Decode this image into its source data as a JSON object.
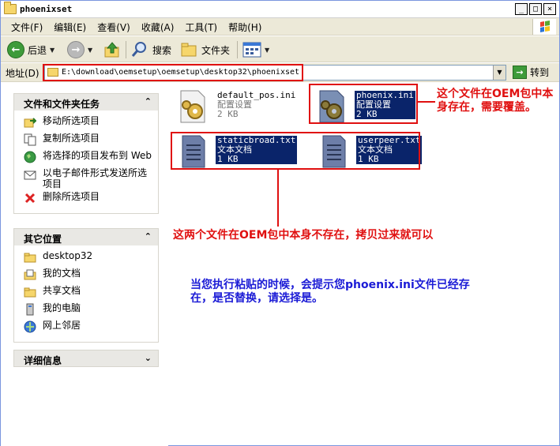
{
  "window": {
    "title": "phoenixset",
    "buttons": [
      "_",
      "□",
      "×"
    ]
  },
  "menu": {
    "items": [
      "文件(F)",
      "编辑(E)",
      "查看(V)",
      "收藏(A)",
      "工具(T)",
      "帮助(H)"
    ]
  },
  "toolbar": {
    "back_label": "后退",
    "search_label": "搜索",
    "folders_label": "文件夹"
  },
  "address": {
    "label": "地址(D)",
    "path": "E:\\download\\oemsetup\\oemsetup\\desktop32\\phoenixset",
    "go_label": "转到"
  },
  "side": {
    "tasks": {
      "title": "文件和文件夹任务",
      "items": [
        {
          "label": "移动所选项目"
        },
        {
          "label": "复制所选项目"
        },
        {
          "label": "将选择的项目发布到 Web"
        },
        {
          "label": "以电子邮件形式发送所选项目"
        },
        {
          "label": "删除所选项目"
        }
      ]
    },
    "places": {
      "title": "其它位置",
      "items": [
        {
          "label": "desktop32"
        },
        {
          "label": "我的文档"
        },
        {
          "label": "共享文档"
        },
        {
          "label": "我的电脑"
        },
        {
          "label": "网上邻居"
        }
      ]
    },
    "details": {
      "title": "详细信息"
    }
  },
  "files": [
    {
      "name": "default_pos.ini",
      "type": "配置设置",
      "size": "2 KB"
    },
    {
      "name": "phoenix.ini",
      "type": "配置设置",
      "size": "2 KB"
    },
    {
      "name": "staticbroad.txt",
      "type": "文本文档",
      "size": "1 KB"
    },
    {
      "name": "userpeer.txt",
      "type": "文本文档",
      "size": "1 KB"
    }
  ],
  "annotations": {
    "exists": "这个文件在OEM包中本身存在，需要覆盖。",
    "not_exists": "这两个文件在OEM包中本身不存在，拷贝过来就可以",
    "paste_hint": "当您执行粘贴的时候，会提示您phoenix.ini文件已经存在，是否替换，请选择是。"
  },
  "colors": {
    "annotation_red": "#e01010",
    "annotation_blue": "#1b1bd6",
    "selection": "#0a246a"
  }
}
